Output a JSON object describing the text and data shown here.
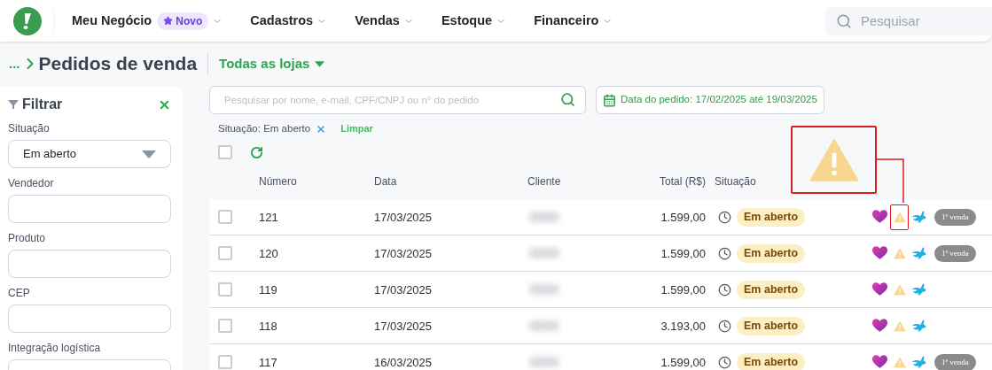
{
  "nav": {
    "items": [
      {
        "label": "Meu Negócio",
        "badge": "Novo"
      },
      {
        "label": "Cadastros"
      },
      {
        "label": "Vendas"
      },
      {
        "label": "Estoque"
      },
      {
        "label": "Financeiro"
      }
    ],
    "search": {
      "placeholder": "Pesquisar"
    }
  },
  "breadcrumb": {
    "ellipsis": "...",
    "title": "Pedidos de venda",
    "store_selector": "Todas as lojas"
  },
  "filter_panel": {
    "title": "Filtrar",
    "fields": [
      {
        "label": "Situação",
        "kind": "select",
        "value": "Em aberto"
      },
      {
        "label": "Vendedor",
        "kind": "text"
      },
      {
        "label": "Produto",
        "kind": "text"
      },
      {
        "label": "CEP",
        "kind": "text"
      },
      {
        "label": "Integração logística",
        "kind": "text"
      }
    ]
  },
  "search": {
    "placeholder": "Pesquisar por nome, e-mail, CPF/CNPJ ou n° do pedido"
  },
  "date_filter": "Data do pedido: 17/02/2025 até 19/03/2025",
  "active_filters": [
    {
      "label": "Situação: Em aberto"
    }
  ],
  "clear_filters": "Limpar",
  "table": {
    "select_all": {
      "checked": false
    },
    "columns": [
      "Número",
      "Data",
      "Cliente",
      "Total (R$)",
      "Situação"
    ],
    "rows": [
      {
        "number": "121",
        "date": "17/03/2025",
        "total": "1.599,00",
        "status": "Em aberto",
        "badge": "1ª venda",
        "checked": false,
        "highlighted": true
      },
      {
        "number": "120",
        "date": "17/03/2025",
        "total": "1.599,00",
        "status": "Em aberto",
        "badge": "1ª venda",
        "checked": false,
        "highlighted": false
      },
      {
        "number": "119",
        "date": "17/03/2025",
        "total": "1.599,00",
        "status": "Em aberto",
        "checked": false,
        "highlighted": false
      },
      {
        "number": "118",
        "date": "17/03/2025",
        "total": "3.193,00",
        "status": "Em aberto",
        "checked": false,
        "highlighted": false
      },
      {
        "number": "117",
        "date": "16/03/2025",
        "total": "1.599,00",
        "status": "Em aberto",
        "badge": "1ª venda",
        "checked": false,
        "highlighted": false
      }
    ]
  }
}
